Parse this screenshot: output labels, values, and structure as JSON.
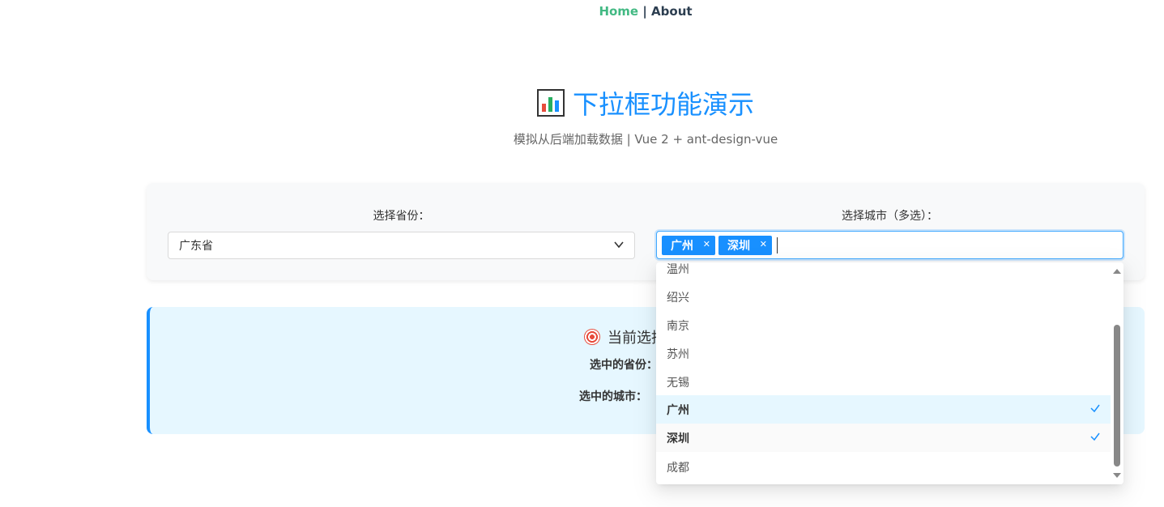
{
  "nav": {
    "home": "Home",
    "separator": " | ",
    "about": "About"
  },
  "header": {
    "title": "下拉框功能演示",
    "subtitle": "模拟从后端加载数据 | Vue 2 + ant-design-vue"
  },
  "form": {
    "province_label": "选择省份：",
    "province_value": "广东省",
    "city_label": "选择城市（多选）：",
    "city_tags": [
      "广州",
      "深圳"
    ]
  },
  "result": {
    "title": "当前选择",
    "province_label": "选中的省份：",
    "city_label": "选中的城市："
  },
  "dropdown": {
    "options": [
      {
        "label": "温州",
        "state": "normal"
      },
      {
        "label": "绍兴",
        "state": "normal"
      },
      {
        "label": "南京",
        "state": "normal"
      },
      {
        "label": "苏州",
        "state": "normal"
      },
      {
        "label": "无锡",
        "state": "normal"
      },
      {
        "label": "广州",
        "state": "selected"
      },
      {
        "label": "深圳",
        "state": "selected-hover"
      },
      {
        "label": "成都",
        "state": "normal"
      }
    ]
  },
  "colors": {
    "primary": "#1890ff",
    "nav_active": "#42b983",
    "result_bg": "#e6f7ff"
  },
  "icons": {
    "title": "bar-chart-icon",
    "result": "target-icon",
    "province_arrow": "chevron-down-icon",
    "check": "check-icon"
  }
}
